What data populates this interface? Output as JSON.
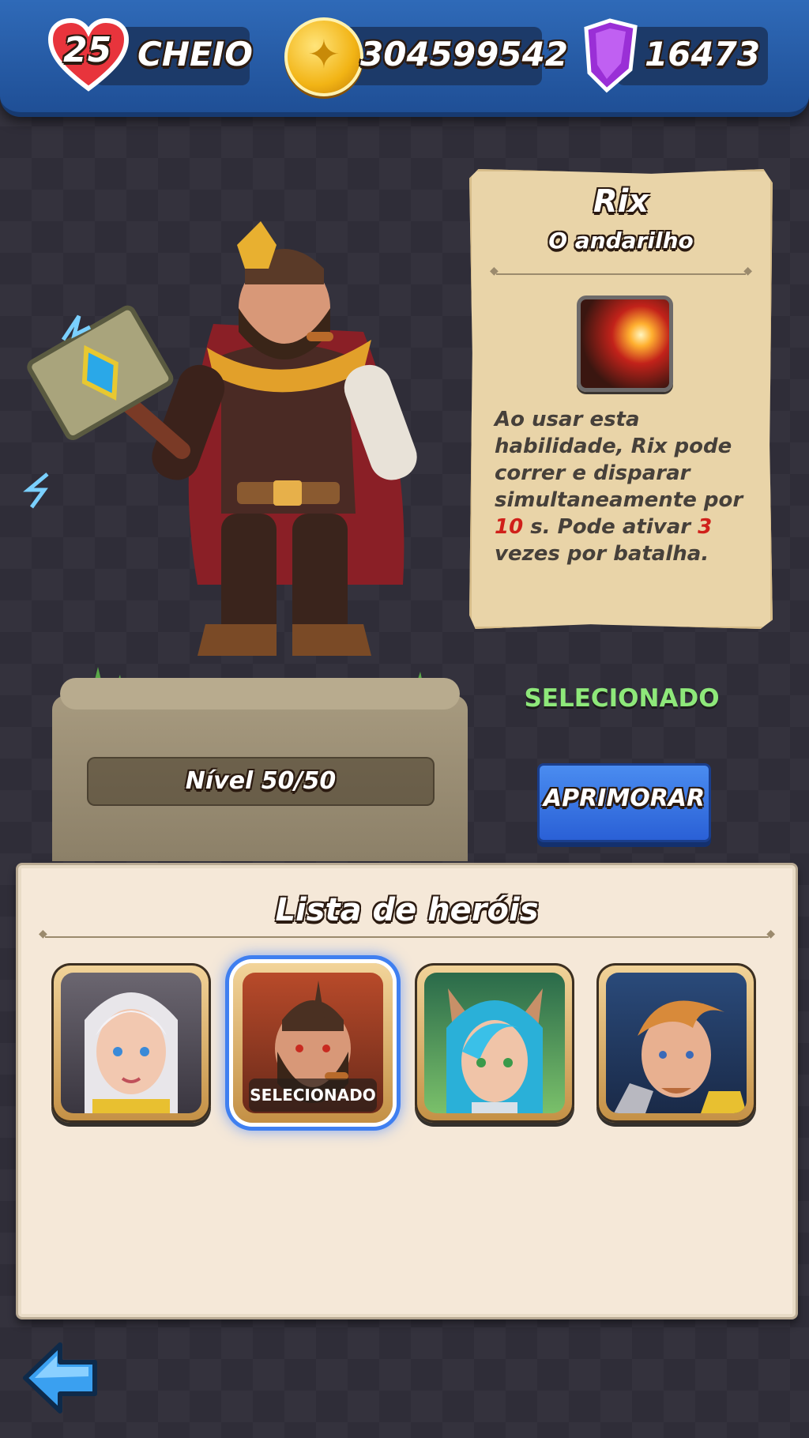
{
  "resources": {
    "lives_count": "25",
    "lives_status": "CHEIO",
    "coins": "304599542",
    "gems": "16473"
  },
  "hero": {
    "name": "Rix",
    "subtitle": "O andarilho",
    "level": "Nível 50/50",
    "skill_desc_part1": "Ao usar esta habilidade, Rix pode correr e disparar simultaneamente por ",
    "skill_duration": "10",
    "skill_desc_part2": " s. Pode ativar ",
    "skill_uses": "3",
    "skill_desc_part3": " vezes por batalha.",
    "status": "SELECIONADO",
    "upgrade_label": "APRIMORAR"
  },
  "hero_list": {
    "title": "Lista de heróis",
    "selected_tag": "SELECIONADO"
  },
  "colors": {
    "topbar": "#2f6ab8",
    "selected_status": "#8ee87a",
    "upgrade_button": "#2a60d6",
    "highlight_number": "#d0201a"
  },
  "icons": [
    "heart-icon",
    "coin-icon",
    "gem-icon",
    "skill-icon",
    "back-arrow-icon"
  ]
}
